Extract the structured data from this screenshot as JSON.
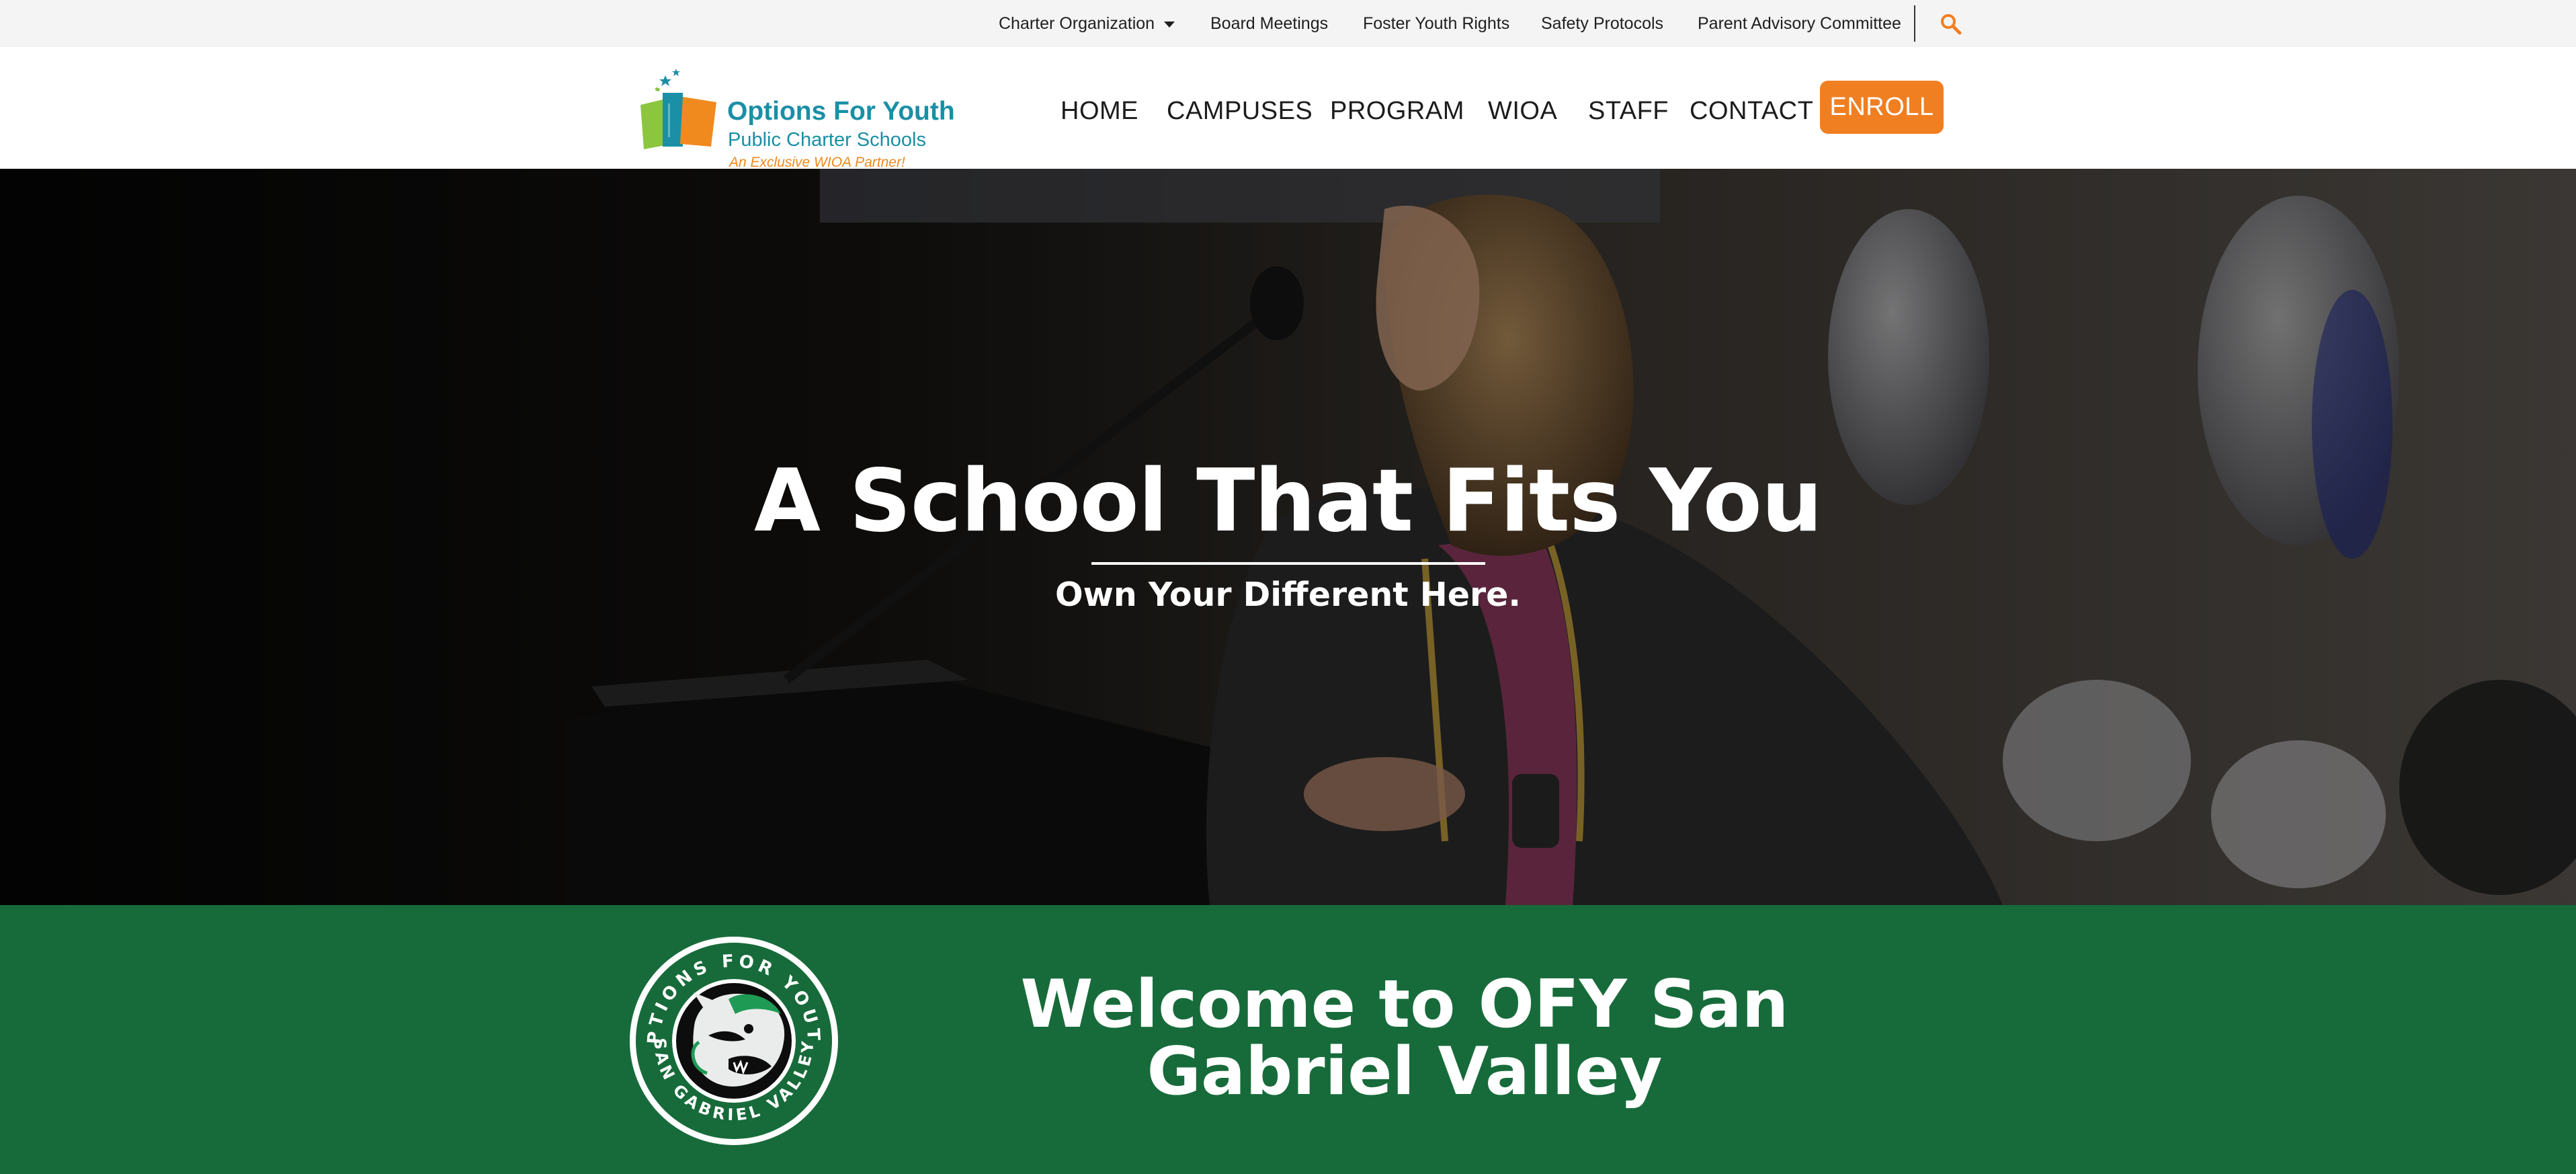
{
  "topbar": {
    "items": [
      {
        "label": "Charter Organization",
        "has_dropdown": true
      },
      {
        "label": "Board Meetings"
      },
      {
        "label": "Foster Youth Rights"
      },
      {
        "label": "Safety Protocols"
      },
      {
        "label": "Parent Advisory Committee"
      }
    ],
    "search_icon": "search-icon",
    "accent_color": "#f07f22"
  },
  "header": {
    "logo": {
      "title": "Options For Youth",
      "subtitle": "Public Charter Schools",
      "tagline": "An Exclusive WIOA Partner!"
    },
    "nav": [
      "HOME",
      "CAMPUSES",
      "PROGRAM",
      "WIOA",
      "STAFF",
      "CONTACT"
    ],
    "enroll_label": "ENROLL",
    "enroll_color": "#f07f22"
  },
  "hero": {
    "title": "A School That Fits You",
    "subtitle": "Own Your Different Here."
  },
  "welcome": {
    "title": "Welcome to OFY San Gabriel Valley",
    "badge_text_top": "OPTIONS FOR YOUTH",
    "badge_text_bottom": "SAN GABRIEL VALLEY",
    "band_color": "#176b3a"
  }
}
